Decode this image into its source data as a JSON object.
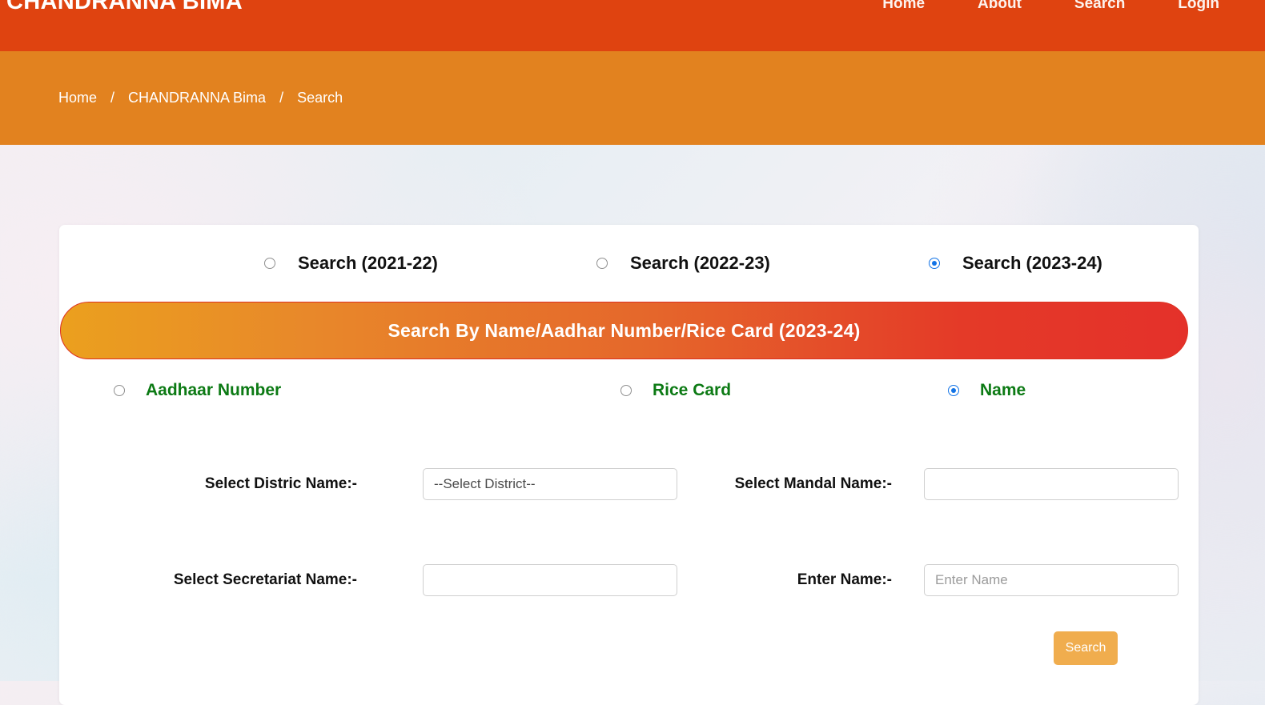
{
  "header": {
    "brand": "CHANDRANNA BIMA",
    "nav": [
      {
        "label": "Home"
      },
      {
        "label": "About"
      },
      {
        "label": "Search"
      },
      {
        "label": "Login"
      }
    ]
  },
  "breadcrumb": {
    "items": [
      {
        "label": "Home"
      },
      {
        "label": "CHANDRANNA Bima"
      },
      {
        "label": "Search"
      }
    ],
    "separator": "/"
  },
  "year_options": [
    {
      "label": "Search (2021-22)",
      "selected": false
    },
    {
      "label": "Search (2022-23)",
      "selected": false
    },
    {
      "label": "Search (2023-24)",
      "selected": true
    }
  ],
  "banner": {
    "title": "Search By Name/Aadhar Number/Rice Card (2023-24)"
  },
  "search_type_options": [
    {
      "label": "Aadhaar Number",
      "selected": false
    },
    {
      "label": "Rice Card",
      "selected": false
    },
    {
      "label": "Name",
      "selected": true
    }
  ],
  "form": {
    "district": {
      "label": "Select Distric Name:-",
      "value": "--Select District--",
      "placeholder": ""
    },
    "mandal": {
      "label": "Select Mandal Name:-",
      "value": "",
      "placeholder": ""
    },
    "secretariat": {
      "label": "Select Secretariat Name:-",
      "value": "",
      "placeholder": ""
    },
    "name": {
      "label": "Enter Name:-",
      "value": "",
      "placeholder": "Enter Name"
    },
    "submit_label": "Search"
  },
  "colors": {
    "header_bg": "#df4310",
    "breadcrumb_bg": "#e2821f",
    "banner_from": "#eba01e",
    "banner_to": "#e4312a",
    "banner_border": "#dd2f20",
    "green_label": "#0c7a14",
    "radio_on": "#1273e6",
    "button_bg": "#f0ad4e"
  }
}
